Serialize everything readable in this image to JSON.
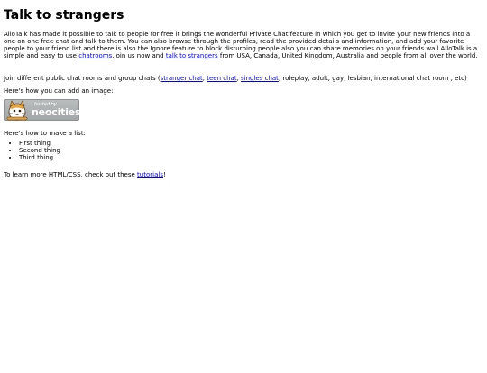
{
  "page": {
    "title": "Talk to strangers",
    "intro": {
      "text_before_link": "AlloTalk has made it possible to talk to people for free it brings the wonderful Private Chat feature in which you get to invite your new friends into a one on one free chat and talk to them. You can also browse through the profiles, read the provided details and information, and add your favorite people to your friend list and there is also the Ignore feature to block disturbing people.also you can share memories on your friends wall.AlloTalk is a simple and easy to use ",
      "link1": "chatrooms",
      "text_middle": ".Join us now and ",
      "link2": "talk to strangers",
      "text_after": " from USA, Canada, United Kingdom, Australia and people from all over the world."
    },
    "rooms": {
      "text_before": "Join different public chat rooms and group chats (",
      "link1": "stranger chat",
      "sep1": ", ",
      "link2": "teen chat",
      "sep2": ", ",
      "link3": "singles chat",
      "text_after": ", roleplay, adult, gay, lesbian, international chat room , etc)"
    },
    "image_intro": "Here's how you can add an image:",
    "badge": {
      "hosted_by": "hosted by",
      "brand": "neocities",
      "icon": "neocities-cat-icon"
    },
    "list_intro": "Here's how to make a list:",
    "list_items": [
      "First thing",
      "Second thing",
      "Third thing"
    ],
    "outro": {
      "text_before": "To learn more HTML/CSS, check out these ",
      "link": "tutorials",
      "text_after": "!"
    }
  },
  "colors": {
    "link": "#0000ee",
    "badge_bg": "#a8acac",
    "cat_orange": "#e8a33c"
  }
}
